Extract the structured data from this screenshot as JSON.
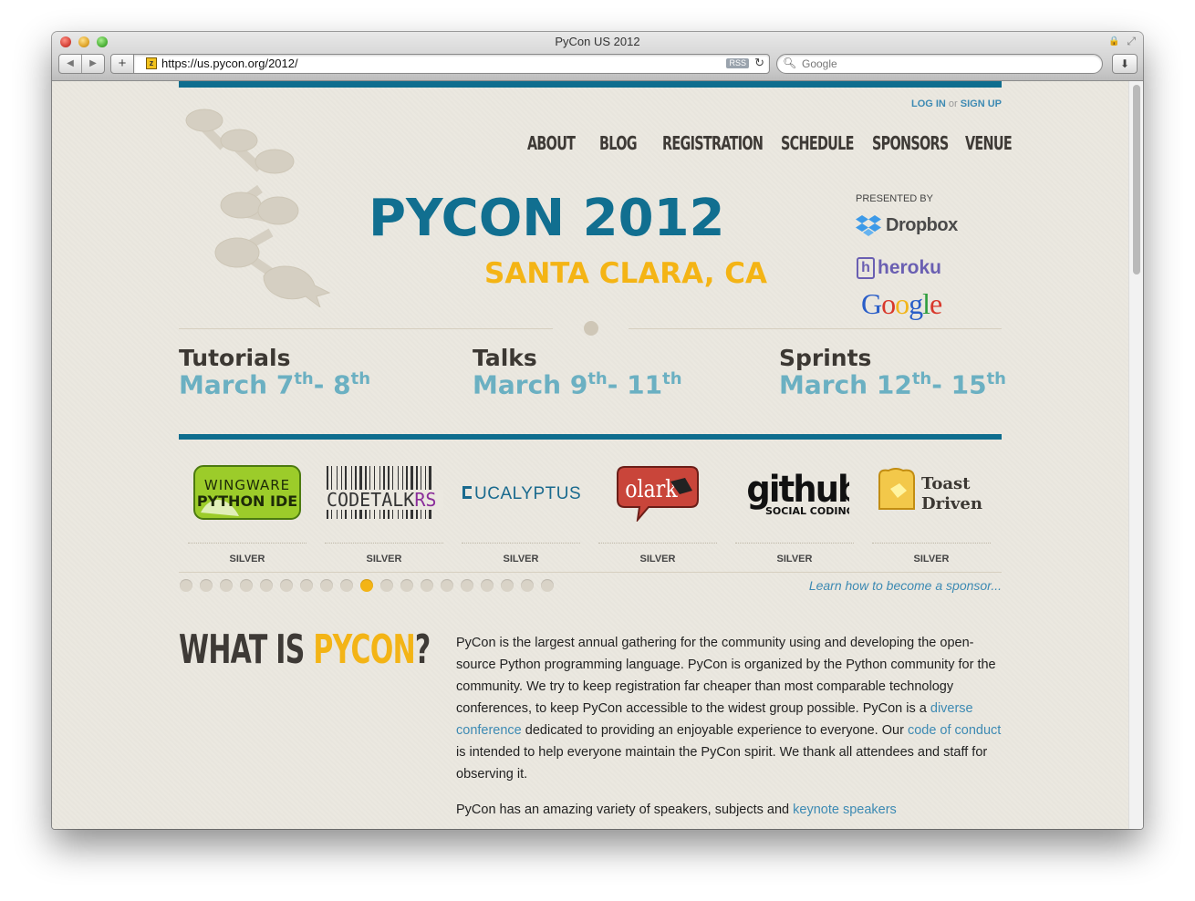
{
  "browser": {
    "title": "PyCon US 2012",
    "url": "https://us.pycon.org/2012/",
    "rss_label": "RSS",
    "search_placeholder": "Google"
  },
  "header": {
    "login": "LOG IN",
    "or": "or",
    "signup": "SIGN UP",
    "nav": [
      "ABOUT",
      "BLOG",
      "REGISTRATION",
      "SCHEDULE",
      "SPONSORS",
      "VENUE"
    ]
  },
  "hero": {
    "title": "PYCON 2012",
    "location": "SANTA CLARA, CA",
    "presented_by": "PRESENTED BY",
    "presenters": [
      "Dropbox",
      "heroku",
      "Google"
    ]
  },
  "dates": [
    {
      "label": "Tutorials",
      "start": "March 7",
      "start_suffix": "th",
      "end": "8",
      "end_suffix": "th"
    },
    {
      "label": "Talks",
      "start": "March 9",
      "start_suffix": "th",
      "end": "11",
      "end_suffix": "th"
    },
    {
      "label": "Sprints",
      "start": "March 12",
      "start_suffix": "th",
      "end": "15",
      "end_suffix": "th"
    }
  ],
  "sponsors": [
    {
      "name": "WINGWARE PYTHON IDE",
      "tier": "SILVER"
    },
    {
      "name": "CODETALKRS",
      "tier": "SILVER"
    },
    {
      "name": "EUCALYPTUS",
      "tier": "SILVER"
    },
    {
      "name": "olark",
      "tier": "SILVER"
    },
    {
      "name": "github SOCIAL CODING",
      "tier": "SILVER"
    },
    {
      "name": "Toast Driven",
      "tier": "SILVER"
    }
  ],
  "carousel": {
    "total": 19,
    "active": 9
  },
  "learn_link": "Learn how to become a sponsor...",
  "about": {
    "heading_part1": "WHAT IS ",
    "heading_highlight": "PYCON",
    "heading_end": "?",
    "p1_a": "PyCon is the largest annual gathering for the community using and developing the open-source Python programming language. PyCon is organized by the Python community for the community. We try to keep registration far cheaper than most comparable technology conferences, to keep PyCon accessible to the widest group possible. PyCon is a ",
    "p1_link1": "diverse conference",
    "p1_b": " dedicated to providing an enjoyable experience to everyone. Our ",
    "p1_link2": "code of conduct",
    "p1_c": " is intended to help everyone maintain the PyCon spirit. We thank all attendees and staff for observing it.",
    "p2_a": "PyCon has an amazing variety of speakers, subjects and ",
    "p2_link": "keynote speakers"
  },
  "colors": {
    "brand_blue": "#116f90",
    "accent_yellow": "#f3b416",
    "link_blue": "#3d8ab3",
    "date_blue": "#6bb0c2"
  }
}
